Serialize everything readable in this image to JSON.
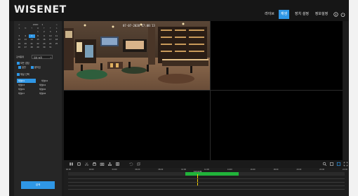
{
  "app": {
    "logo": "WISENET"
  },
  "nav": {
    "live": "라이브",
    "search": "재생",
    "setup": "장치 설정",
    "info": "정보설정"
  },
  "calendar": {
    "year": "2020",
    "month": "1",
    "weekdays": [
      "S",
      "M",
      "T",
      "W",
      "T",
      "F",
      "S"
    ],
    "days": [
      "",
      "",
      "",
      "1",
      "2",
      "3",
      "4",
      "5",
      "6",
      "7",
      "8",
      "9",
      "10",
      "11",
      "12",
      "13",
      "14",
      "15",
      "16",
      "17",
      "18",
      "19",
      "20",
      "21",
      "22",
      "23",
      "24",
      "25",
      "26",
      "27",
      "28",
      "29",
      "30",
      "31",
      ""
    ],
    "selected_day": "7"
  },
  "search_type": {
    "label": "검색종류",
    "value": "일반 녹화"
  },
  "options": {
    "overlap": "모든 겹침",
    "normal": "일반",
    "event": "움직임",
    "channel_select": "채널 선택"
  },
  "channels": [
    [
      "채널01",
      "채널02"
    ],
    [
      "채널03",
      "채널04"
    ],
    [
      "채널05",
      "채널06"
    ],
    [
      "채널07",
      "채널08"
    ]
  ],
  "search_button": "검색",
  "camera": {
    "timestamp": "07-07-2020 17:00:13"
  },
  "timeline": {
    "ticks": [
      "00:00",
      "02:00",
      "04:00",
      "06:00",
      "08:00",
      "10:00",
      "12:00",
      "14:00",
      "16:00",
      "18:00",
      "20:00",
      "22:00",
      "24:00"
    ],
    "cursor_label": "11:11:01",
    "recording_start_hour": 10.2,
    "recording_end_hour": 14.8,
    "cursor_hour": 11.2
  },
  "colors": {
    "accent": "#2f97e6",
    "record": "#21b33a"
  }
}
